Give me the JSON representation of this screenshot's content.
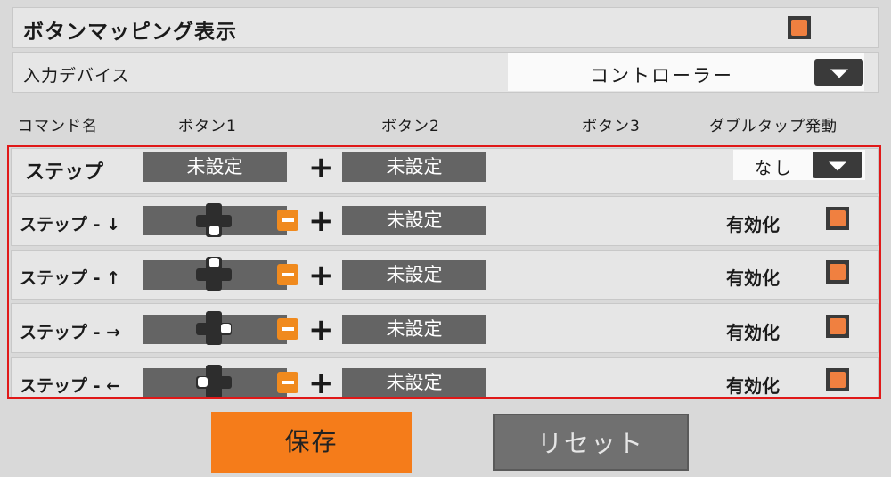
{
  "settings": {
    "button_mapping_label": "ボタンマッピング表示",
    "input_device_label": "入力デバイス",
    "input_device_value": "コントローラー"
  },
  "table_header": {
    "command": "コマンド名",
    "button1": "ボタン1",
    "button2": "ボタン2",
    "button3": "ボタン3",
    "double_tap": "ダブルタップ発動"
  },
  "rows": [
    {
      "command": "ステップ",
      "button1": "未設定",
      "plus": "+",
      "button2": "未設定",
      "double_tap_value": "なし"
    },
    {
      "command": "ステップ - ↓",
      "plus": "+",
      "button2": "未設定",
      "enable_label": "有効化"
    },
    {
      "command": "ステップ - ↑",
      "plus": "+",
      "button2": "未設定",
      "enable_label": "有効化"
    },
    {
      "command": "ステップ - →",
      "plus": "+",
      "button2": "未設定",
      "enable_label": "有効化"
    },
    {
      "command": "ステップ - ←",
      "plus": "+",
      "button2": "未設定",
      "enable_label": "有効化"
    }
  ],
  "actions": {
    "save": "保存",
    "reset": "リセット"
  },
  "colors": {
    "accent": "#f57c1a",
    "checkbox_fill": "#f08040",
    "highlight_frame": "#e01818",
    "slot": "#646464"
  },
  "icons": {
    "dropdown": "chevron-down-icon",
    "dpad": "dpad-icon",
    "minus": "minus-icon"
  }
}
